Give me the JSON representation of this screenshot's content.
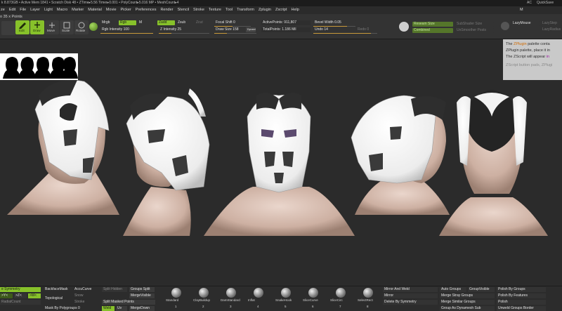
{
  "status_bar": {
    "text": "k 8.873GB • Active Mem 1841 • Scratch Disk 48 • ZTime▸5.56 Timer▸0.001 • PolyCount▸5.016 MP • MeshCount▸4",
    "right_ac": "AC",
    "right_quicksave": "QuickSave"
  },
  "menu": {
    "items": [
      "ze",
      "Edit",
      "File",
      "Layer",
      "Light",
      "Macro",
      "Marker",
      "Material",
      "Movie",
      "Picker",
      "Preferences",
      "Render",
      "Stencil",
      "Stroke",
      "Texture",
      "Tool",
      "Transform",
      "Zplugin",
      "Zscript",
      "Help"
    ],
    "right_text": "M"
  },
  "top_left_label": "o 35 x Points",
  "toolbar": {
    "edit": "Edit",
    "draw": "Draw",
    "move": "Move",
    "scale": "Scale",
    "rotate": "Rotate",
    "mrgb": "Mrgb",
    "rgb": "Rgb",
    "m": "M",
    "rgb_intensity": "Rgb Intensity 100",
    "zadd": "Zadd",
    "zsub": "Zsub",
    "zcut": "Zcut",
    "z_intensity": "Z Intensity 25",
    "focal_shift": "Focal Shift 0",
    "draw_size": "Draw Size 158",
    "dynamic": "Dynamic",
    "active_points": "ActivePoints: 911,807",
    "total_points": "TotalPoints: 1.186 Mil",
    "bevel_width": "Bevel Width 0.05",
    "undo": "Undo 14",
    "redo": "Redo 0",
    "reseam": "Reseam Size",
    "subshader": "SubShader Size",
    "combined": "Combined",
    "unsmooth": "UnSmoother Posts",
    "lazymouse": "LazyMouse",
    "lazystep": "LazyStep",
    "lazyradius": "LazyRadius"
  },
  "tooltip": {
    "line1_a": "The ",
    "line1_hl": "ZPlugin",
    "line1_b": " palette conta",
    "line2": "ZPlugin palette, place it in",
    "line3_a": "The ZScript will appear ",
    "line3_hl": "in",
    "line4": "ZScript button pads, ZPlugi"
  },
  "bottom": {
    "symmetry": "e Symmetry",
    "py": ">Y<",
    "pz": ">Z<",
    "pm": ">M<",
    "radialcount": "RadialCount",
    "backfacemask": "BackfaceMask",
    "topological": "Topological",
    "mask_by_polygroups": "Mask By Polygroups 0",
    "accucurve": "AccuCurve",
    "snow": "Snow",
    "stroke": "Stroke",
    "split_hidden": "Split Hidden",
    "groups_split": "Groups Split",
    "merge_visible": "MergeVisible",
    "split_masked": "Split Masked Points",
    "weld": "Weld",
    "uv": "Uv",
    "merge_down": "MergeDown",
    "brushes": [
      "Standard",
      "ClayBuildup",
      "DamStandard",
      "Inflat",
      "SnakeHook",
      "SliceCurve",
      "SliceCirc",
      "SelectRect"
    ],
    "brush_numbers": [
      "1",
      "2",
      "3",
      "4",
      "5",
      "6",
      "7",
      "8"
    ],
    "mirror_and_weld": "Mirror And Weld",
    "mirror": "Mirror",
    "delete_by_symmetry": "Delete By Symmetry",
    "auto_groups": "Auto Groups",
    "group_visible": "GroupVisible",
    "merge_stray_groups": "Merge Stray Groups",
    "merge_similar_groups": "Merge Similar Groups",
    "group_as_dynamesh": "Group As Dynamesh Sub",
    "polish_by_groups": "Polish By Groups",
    "polish_by_features": "Polish By Features",
    "polish": "Polish",
    "unweld_groups_border": "Unweld Groups Border"
  },
  "colors": {
    "accent_green": "#87c12a",
    "slider_orange": "#c89a3a",
    "canvas": "#2b2b2b",
    "mask_white": "#f2f2f2",
    "skin": "#d8c0b4"
  },
  "icons": [
    "edit-icon",
    "draw-icon",
    "move-icon",
    "scale-icon",
    "rotate-icon",
    "rgb-sphere-icon",
    "zplugin-icon",
    "lazymouse-icon",
    "brush-sphere-icon"
  ]
}
